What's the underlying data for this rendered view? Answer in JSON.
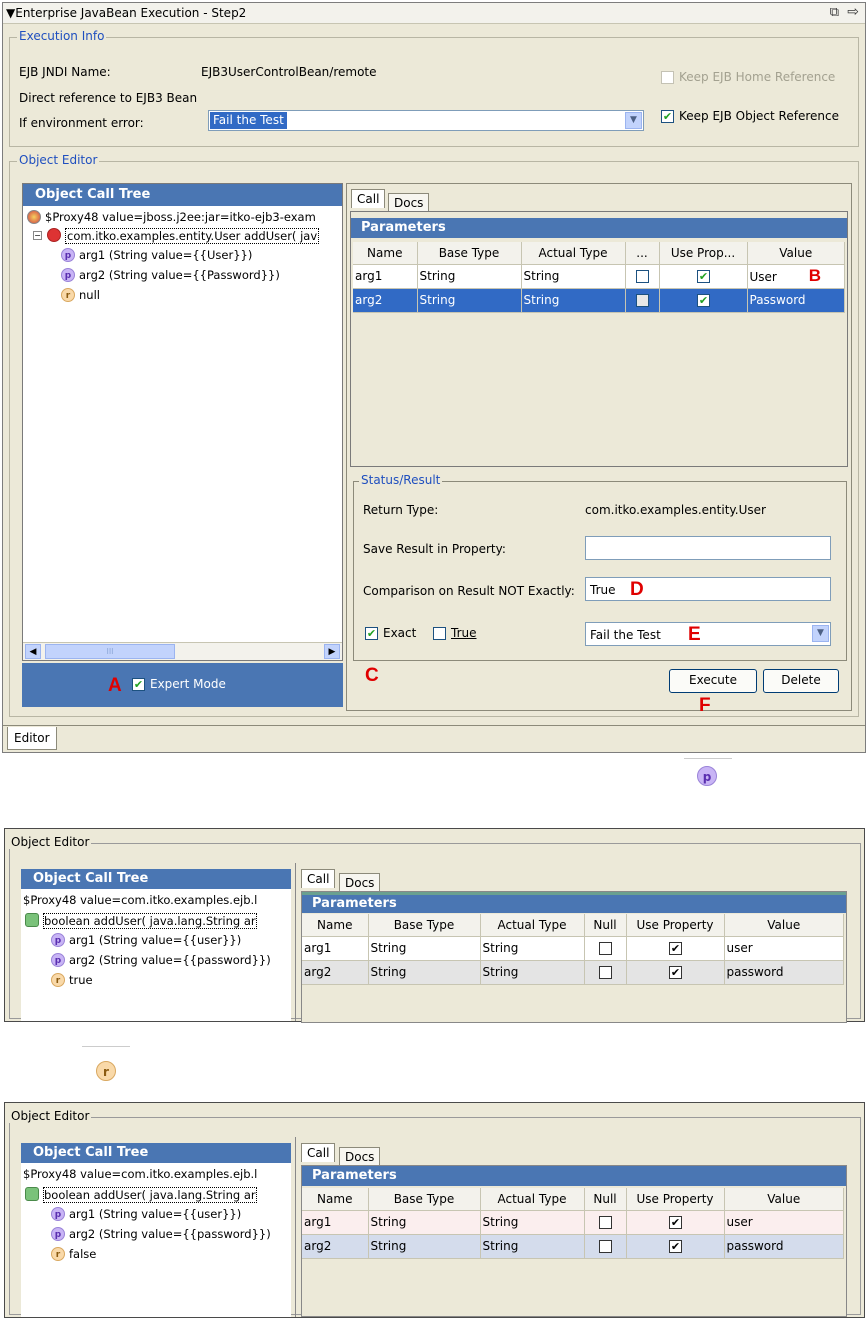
{
  "main": {
    "window_title": "Enterprise JavaBean Execution - Step2",
    "execution_info": {
      "legend": "Execution Info",
      "jndi_label": "EJB JNDI Name:",
      "jndi_value": "EJB3UserControlBean/remote",
      "direct_ref": "Direct reference to EJB3 Bean",
      "env_error_label": "If environment error:",
      "env_error_value": "Fail the Test",
      "keep_home": "Keep EJB Home Reference",
      "keep_object": "Keep EJB Object Reference"
    },
    "object_editor": {
      "legend": "Object Editor",
      "tree_title": "Object Call Tree",
      "tree_items": [
        "$Proxy48 value=jboss.j2ee:jar=itko-ejb3-exam",
        "com.itko.examples.entity.User addUser( jav",
        "arg1 (String value={{User}})",
        "arg2 (String value={{Password}})",
        "null"
      ],
      "expert_mode": "Expert Mode",
      "tabs": [
        "Call",
        "Docs"
      ],
      "params_title": "Parameters",
      "columns": [
        "Name",
        "Base Type",
        "Actual Type",
        "...",
        "Use Prop...",
        "Value"
      ],
      "rows": [
        {
          "name": "arg1",
          "base": "String",
          "actual": "String",
          "value": "User"
        },
        {
          "name": "arg2",
          "base": "String",
          "actual": "String",
          "value": "Password"
        }
      ],
      "status": {
        "legend": "Status/Result",
        "return_type_label": "Return Type:",
        "return_type_value": "com.itko.examples.entity.User",
        "save_label": "Save Result in Property:",
        "comparison_label": "Comparison on Result NOT Exactly:",
        "comparison_value": "True",
        "exact": "Exact",
        "true": "True",
        "fail_value": "Fail the Test"
      },
      "execute": "Execute",
      "delete": "Delete"
    },
    "editor_tab": "Editor",
    "scroll_thumb": "III",
    "markers": {
      "a": "A",
      "b": "B",
      "c": "C",
      "d": "D",
      "e": "E",
      "f": "F"
    }
  },
  "icons": {
    "p": "p",
    "r": "r"
  },
  "panel2": {
    "legend": "Object Editor",
    "tree_title": "Object Call Tree",
    "tree_items": [
      "$Proxy48 value=com.itko.examples.ejb.l",
      "boolean addUser( java.lang.String ar",
      "arg1 (String value={{user}})",
      "arg2 (String value={{password}})",
      "true"
    ],
    "tabs": [
      "Call",
      "Docs"
    ],
    "params_title": "Parameters",
    "columns": [
      "Name",
      "Base Type",
      "Actual Type",
      "Null",
      "Use Property",
      "Value"
    ],
    "rows": [
      {
        "name": "arg1",
        "base": "String",
        "actual": "String",
        "value": "user"
      },
      {
        "name": "arg2",
        "base": "String",
        "actual": "String",
        "value": "password"
      }
    ]
  },
  "panel3": {
    "legend": "Object Editor",
    "tree_title": "Object Call Tree",
    "tree_items": [
      "$Proxy48 value=com.itko.examples.ejb.l",
      "boolean addUser( java.lang.String ar",
      "arg1 (String value={{user}})",
      "arg2 (String value={{password}})",
      "false"
    ],
    "tabs": [
      "Call",
      "Docs"
    ],
    "params_title": "Parameters",
    "columns": [
      "Name",
      "Base Type",
      "Actual Type",
      "Null",
      "Use Property",
      "Value"
    ],
    "rows": [
      {
        "name": "arg1",
        "base": "String",
        "actual": "String",
        "value": "user"
      },
      {
        "name": "arg2",
        "base": "String",
        "actual": "String",
        "value": "password"
      }
    ]
  }
}
